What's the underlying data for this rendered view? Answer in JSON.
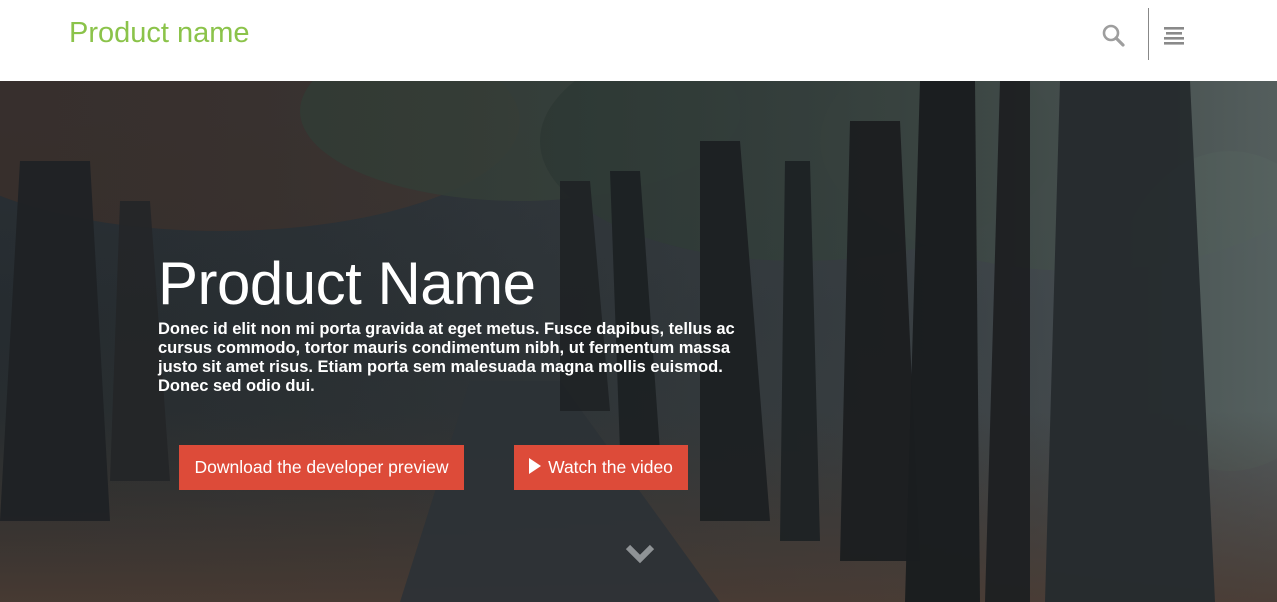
{
  "header": {
    "brand": "Product name",
    "brand_color": "#8bc34a",
    "search_icon": "search-icon",
    "menu_icon": "menu-icon"
  },
  "hero": {
    "title": "Product Name",
    "description": "Donec id elit non mi porta gravida at eget metus. Fusce dapibus, tellus ac cursus commodo, tortor mauris condimentum nibh, ut fermentum massa justo sit amet risus. Etiam porta sem malesuada magna mollis euismod. Donec sed odio dui.",
    "primary_button": "Download the developer preview",
    "secondary_button": "Watch the video",
    "secondary_button_icon": "play-icon",
    "scroll_icon": "chevron-down-icon",
    "accent_color": "#dd4b39"
  }
}
